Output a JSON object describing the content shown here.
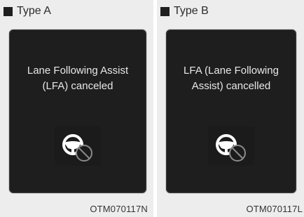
{
  "panels": [
    {
      "label": "Type A",
      "message_line1": "Lane Following Assist",
      "message_line2": "(LFA) canceled",
      "code": "OTM070117N",
      "icon": "steering-wheel-canceled-icon"
    },
    {
      "label": "Type B",
      "message_line1": "LFA (Lane Following",
      "message_line2": "Assist) cancelled",
      "code": "OTM070117L",
      "icon": "steering-wheel-canceled-icon"
    }
  ],
  "colors": {
    "panel_bg": "#ededed",
    "screen_bg": "#1e1e1e",
    "text_on_screen": "#e8e8e8",
    "icon_color": "#ffffff",
    "cancel_color": "#8a8a8a"
  }
}
